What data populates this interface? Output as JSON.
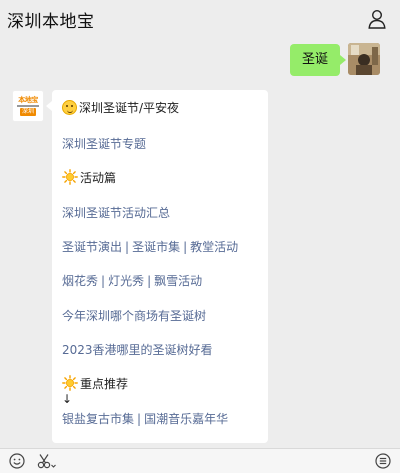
{
  "header": {
    "title": "深圳本地宝",
    "profile_icon": "person-icon"
  },
  "messages": {
    "outgoing": {
      "text": "圣诞"
    },
    "incoming": {
      "avatar_text_top": "本地宝",
      "avatar_text_bottom": "深圳",
      "lines": {
        "heading": "深圳圣诞节/平安夜",
        "topic_link": "深圳圣诞节专题",
        "section_activities": "活动篇",
        "activities_summary_link": "深圳圣诞节活动汇总",
        "show_link": "圣诞节演出",
        "market_link": "圣诞市集",
        "church_link": "教堂活动",
        "fireworks_link": "烟花秀",
        "lightshow_link": "灯光秀",
        "snow_link": "飘雪活动",
        "tree_link": "今年深圳哪个商场有圣诞树",
        "hk_tree_link": "2023香港哪里的圣诞树好看",
        "section_recommend": "重点推荐",
        "arrow": "↓",
        "silver_market_link": "银盐复古市集",
        "music_carnival_link": "国潮音乐嘉年华"
      },
      "separator": "|"
    }
  },
  "colors": {
    "link": "#576b95",
    "bubble_green": "#95ec69",
    "background": "#ededed"
  },
  "toolbar": {
    "emoji_icon": "emoji-icon",
    "scissors_icon": "scissors-icon",
    "menu_icon": "menu-icon"
  }
}
